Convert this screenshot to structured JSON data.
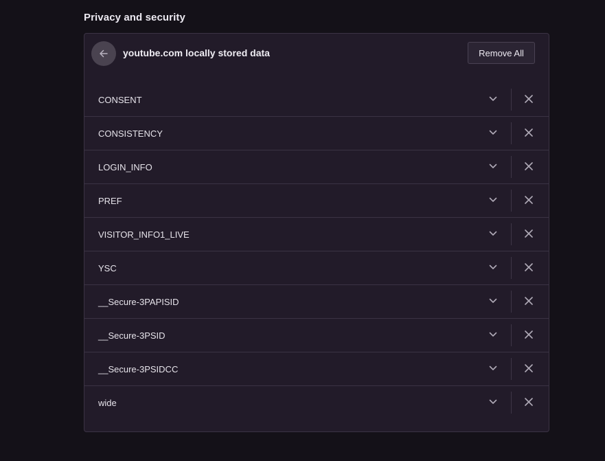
{
  "section": {
    "title": "Privacy and security"
  },
  "header": {
    "title": "youtube.com locally stored data",
    "remove_all_label": "Remove All",
    "back_icon": "arrow-left-icon"
  },
  "items": [
    {
      "label": "CONSENT"
    },
    {
      "label": "CONSISTENCY"
    },
    {
      "label": "LOGIN_INFO"
    },
    {
      "label": "PREF"
    },
    {
      "label": "VISITOR_INFO1_LIVE"
    },
    {
      "label": "YSC"
    },
    {
      "label": "__Secure-3PAPISID"
    },
    {
      "label": "__Secure-3PSID"
    },
    {
      "label": "__Secure-3PSIDCC"
    },
    {
      "label": "wide"
    }
  ],
  "icons": {
    "expand": "chevron-down-icon",
    "remove": "close-icon"
  },
  "colors": {
    "background": "#141118",
    "card": "#221b29",
    "border": "#3b3344"
  }
}
